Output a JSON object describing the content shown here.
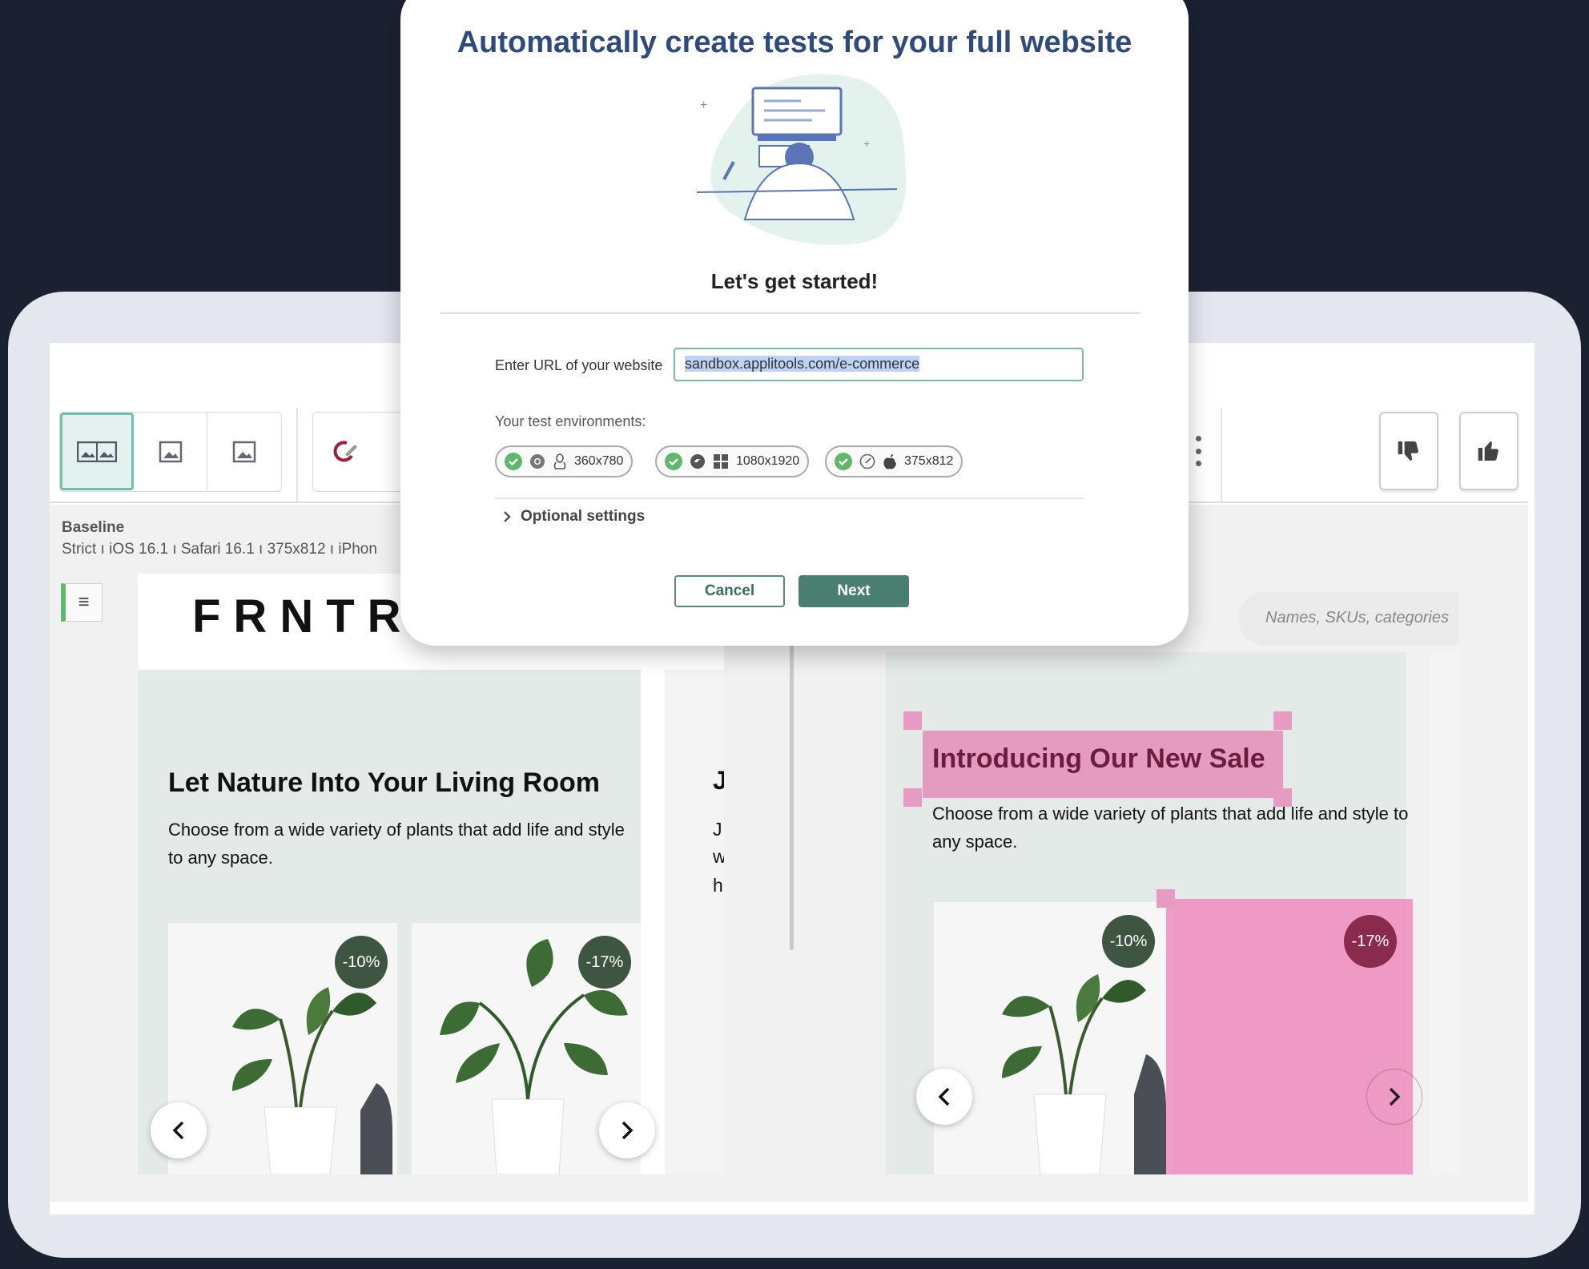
{
  "modal": {
    "title": "Automatically create tests for your full website",
    "subtitle": "Let's get started!",
    "url_label": "Enter URL of your website",
    "url_value": "sandbox.applitools.com/e-commerce",
    "env_label": "Your test environments:",
    "environments": [
      {
        "status_icon": "check-circle-icon",
        "browser_icon": "chrome-icon",
        "os_icon": "linux-icon",
        "resolution": "360x780"
      },
      {
        "status_icon": "check-circle-icon",
        "browser_icon": "edge-icon",
        "os_icon": "windows-icon",
        "resolution": "1080x1920"
      },
      {
        "status_icon": "check-circle-icon",
        "browser_icon": "safari-icon",
        "os_icon": "apple-icon",
        "resolution": "375x812"
      }
    ],
    "optional_settings": "Optional settings",
    "cancel_label": "Cancel",
    "next_label": "Next"
  },
  "toolbar": {
    "view_modes": [
      "side-by-side-icon",
      "image-icon",
      "image-icon"
    ],
    "more_icon": "kebab-icon",
    "thumbs_down_icon": "thumbs-down-icon",
    "thumbs_up_icon": "thumbs-up-icon"
  },
  "baseline": {
    "title": "Baseline",
    "meta": "Strict  ı  iOS 16.1  ı  Safari 16.1  ı  375x812  ı  iPhon"
  },
  "left_page": {
    "logo": "FRNTR",
    "hero_title": "Let Nature Into Your Living Room",
    "hero_text": "Choose from a wide variety of plants that add life and style to any space.",
    "side_title": "J",
    "side_lines": [
      "J",
      "w",
      "h"
    ],
    "badges": [
      "-10%",
      "-17%"
    ]
  },
  "right_page": {
    "search_placeholder": "Names, SKUs, categories",
    "hero_title": "Introducing Our New Sale",
    "hero_text": "Choose from a wide variety of plants that add life and style to any space.",
    "badges": [
      "-10%",
      "-17%"
    ]
  },
  "colors": {
    "page_bg": "#1a2232",
    "modal_title": "#2f4a7c",
    "primary_button": "#4a7e71",
    "diff_highlight": "#e65aa0",
    "badge": "#3e5641",
    "success": "#5fb86a"
  }
}
